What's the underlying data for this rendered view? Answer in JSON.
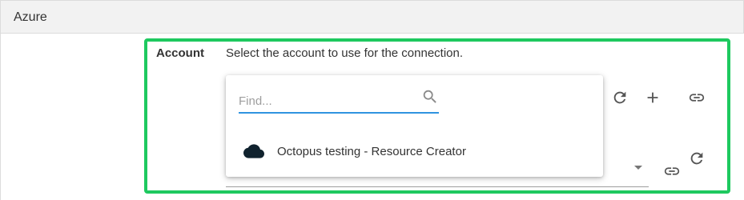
{
  "section": {
    "title": "Azure"
  },
  "account": {
    "label": "Account",
    "description": "Select the account to use for the connection."
  },
  "selector": {
    "search_placeholder": "Find...",
    "items": [
      {
        "label": "Octopus testing - Resource Creator",
        "icon": "cloud-icon"
      }
    ]
  },
  "actions": {
    "icons": [
      "refresh-icon",
      "add-icon",
      "link-icon",
      "refresh-icon",
      "link-icon"
    ]
  },
  "colors": {
    "highlight": "#1ec95f",
    "focus": "#2f93e0",
    "header_bg": "#f2f2f2"
  }
}
